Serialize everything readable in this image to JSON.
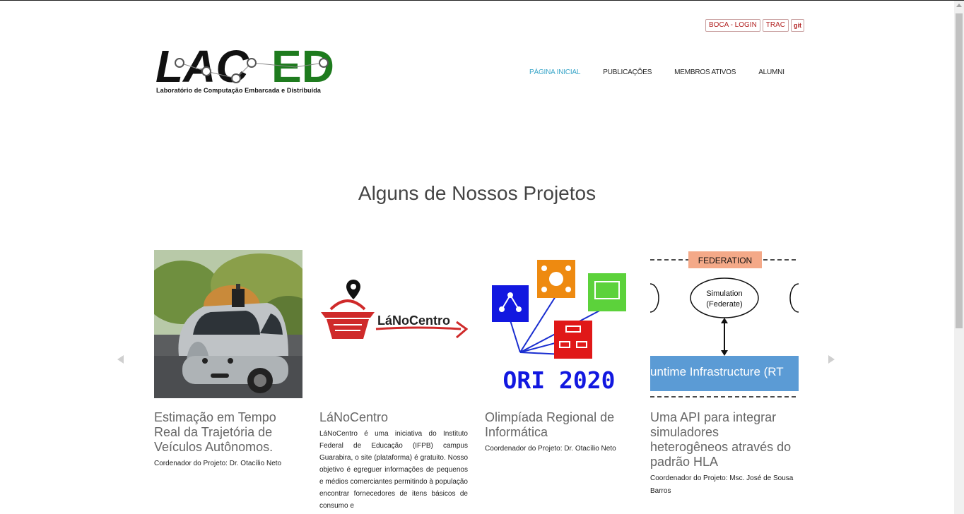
{
  "header": {
    "ext_links": [
      {
        "label": "BOCA - LOGIN"
      },
      {
        "label": "TRAC"
      },
      {
        "label": "git"
      }
    ],
    "logo": {
      "text_black": "LAC",
      "text_green": "ED",
      "caption": "Laboratório de Computação Embarcada e Distribuída"
    },
    "nav": [
      {
        "label": "PÁGINA INICIAL",
        "active": true
      },
      {
        "label": "PUBLICAÇÕES"
      },
      {
        "label": "MEMBROS ATIVOS"
      },
      {
        "label": "ALUMNI"
      }
    ]
  },
  "section": {
    "title": "Alguns de Nossos Projetos"
  },
  "projects": [
    {
      "title": "Estimação em Tempo Real da Trajetória de Veículos Autônomos.",
      "coordinator": "Cordenador do Projeto: Dr. Otacílio Neto",
      "image": "autonomous-car"
    },
    {
      "title": "LáNoCentro",
      "description": "LáNoCentro é uma iniciativa do Instituto Federal de Educação (IFPB) campus Guarabira, o site (plataforma) é gratuito. Nosso objetivo é egreguer informações de pequenos e médios comerciantes permitindo à população encontrar fornecedores de itens básicos de consumo e",
      "image": "lanocentro-logo",
      "logo_text": "LáNoCentro"
    },
    {
      "title": "Olimpíada Regional de Informática",
      "coordinator": "Coordenador do Projeto: Dr. Otacílio Neto",
      "image": "ori-2020",
      "logo_text": "ORI 2020"
    },
    {
      "title": "Uma API para integrar simuladores heterogêneos através do padrão HLA",
      "coordinator": "Coordenador do Projeto: Msc. José de Sousa Barros",
      "image": "hla-federation",
      "diagram": {
        "federation": "FEDERATION",
        "simulation": "Simulation",
        "federate": "(Federate)",
        "rti": "untime Infrastructure (RT"
      }
    }
  ],
  "colors": {
    "accent": "#3aa6c9",
    "logo_green": "#1e7b1e",
    "link_red": "#b22222"
  }
}
